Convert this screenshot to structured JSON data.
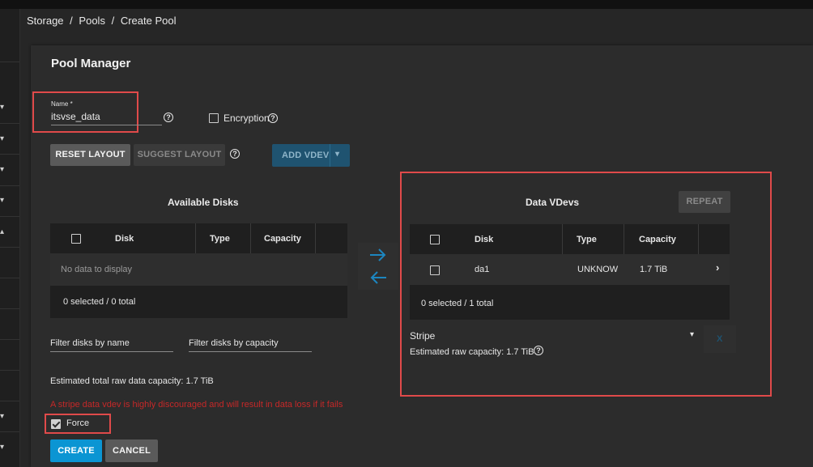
{
  "breadcrumb": [
    "Storage",
    "Pools",
    "Create Pool"
  ],
  "title": "Pool Manager",
  "name_field": {
    "label": "Name *",
    "value": "itsvse_data"
  },
  "encryption": {
    "label": "Encryption",
    "checked": false
  },
  "buttons": {
    "reset_layout": "RESET LAYOUT",
    "suggest_layout": "SUGGEST LAYOUT",
    "add_vdev": "ADD VDEV",
    "repeat": "REPEAT",
    "create": "CREATE",
    "cancel": "CANCEL"
  },
  "available_disks": {
    "title": "Available Disks",
    "columns": [
      "Disk",
      "Type",
      "Capacity"
    ],
    "empty_text": "No data to display",
    "footer": "0 selected / 0 total"
  },
  "data_vdevs": {
    "title": "Data VDevs",
    "columns": [
      "Disk",
      "Type",
      "Capacity"
    ],
    "rows": [
      {
        "disk": "da1",
        "type": "UNKNOW",
        "capacity": "1.7 TiB"
      }
    ],
    "footer": "0 selected / 1 total",
    "layout_value": "Stripe",
    "estimated_raw": "Estimated raw capacity: 1.7 TiB",
    "remove_label": "X"
  },
  "filters": {
    "by_name": "Filter disks by name",
    "by_capacity": "Filter disks by capacity"
  },
  "estimated_total": "Estimated total raw data capacity: 1.7 TiB",
  "warning": "A stripe data vdev is highly discouraged and will result in data loss if it fails",
  "force": {
    "label": "Force",
    "checked": true
  },
  "colors": {
    "accent": "#0b95d3",
    "error": "#c62828",
    "highlight": "#e04a4a"
  }
}
